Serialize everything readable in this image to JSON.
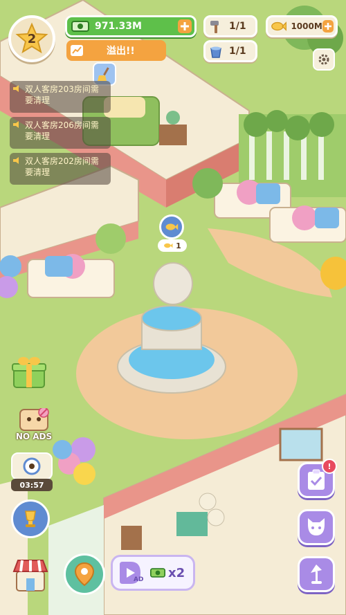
{
  "hud": {
    "level": "2",
    "money": "971.33M",
    "overflow_label": "溢出!!",
    "hammer_count": "1/1",
    "cleaning_count": "1/1",
    "fish_coin_amount": "1000M"
  },
  "notifications": [
    {
      "text": "双人客房203房间需要清理"
    },
    {
      "text": "双人客房206房间需要清理"
    },
    {
      "text": "双人客房202房间需要清理"
    }
  ],
  "fountain_badge": {
    "count": "1"
  },
  "side_left": {
    "no_ads_label": "NO ADS",
    "timer": "03:57"
  },
  "bottom": {
    "ad_label": "AD",
    "multiplier": "x2"
  },
  "right_buttons": {
    "task_badge": "!"
  },
  "colors": {
    "grass": "#b9d77c",
    "money_green": "#5ec04a",
    "overflow_orange": "#f4a340",
    "purple": "#a98be6",
    "wall_pink": "#e9958a",
    "floor_cream": "#f5ecd6"
  },
  "icons": [
    "star-icon",
    "cash-icon",
    "plus-icon",
    "trend-icon",
    "hammer-icon",
    "bucket-icon",
    "fish-coin-icon",
    "gear-icon",
    "speaker-icon",
    "fish-icon",
    "gift-icon",
    "tv-icon",
    "clock-icon",
    "trophy-icon",
    "shop-icon",
    "map-pin-icon",
    "ad-icon",
    "clipboard-icon",
    "cat-icon",
    "lamp-icon",
    "broom-icon"
  ]
}
